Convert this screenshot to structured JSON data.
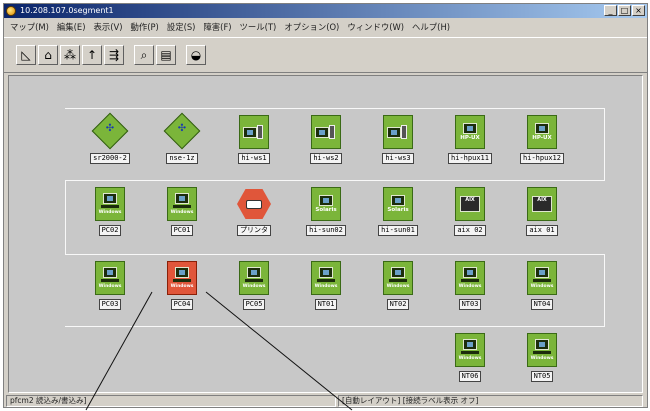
{
  "window": {
    "title": "10.208.107.0segment1",
    "controls": [
      "_",
      "□",
      "×"
    ]
  },
  "menu": [
    "マップ(M)",
    "編集(E)",
    "表示(V)",
    "動作(P)",
    "設定(S)",
    "障害(F)",
    "ツール(T)",
    "オプション(O)",
    "ウィンドウ(W)",
    "ヘルプ(H)"
  ],
  "toolbar": [
    {
      "icon": "triangle-ruler-icon",
      "glyph": "◺"
    },
    {
      "icon": "house-icon",
      "glyph": "⌂"
    },
    {
      "icon": "network-tree-icon",
      "glyph": "⁂"
    },
    {
      "icon": "up-arrow-icon",
      "glyph": "↑"
    },
    {
      "icon": "branch-arrow-icon",
      "glyph": "⇶"
    },
    {
      "icon": "magnifier-icon",
      "glyph": "⌕"
    },
    {
      "icon": "chart-icon",
      "glyph": "▤"
    },
    {
      "icon": "dome-icon",
      "glyph": "◒"
    }
  ],
  "nodes": [
    {
      "label": "sr2000-2",
      "type": "router"
    },
    {
      "label": "nse-1z",
      "type": "router"
    },
    {
      "label": "hi-ws1",
      "type": "server"
    },
    {
      "label": "hi-ws2",
      "type": "server"
    },
    {
      "label": "hi-ws3",
      "type": "server"
    },
    {
      "label": "hi-hpux11",
      "type": "hp",
      "os": "HP-UX"
    },
    {
      "label": "hi-hpux12",
      "type": "hp",
      "os": "HP-UX"
    },
    {
      "label": "PC02",
      "type": "pc",
      "os": "Windows"
    },
    {
      "label": "PC01",
      "type": "pc",
      "os": "Windows"
    },
    {
      "label": "プリンタ",
      "type": "printer"
    },
    {
      "label": "hi-sun02",
      "type": "sun",
      "os": "Solaris"
    },
    {
      "label": "hi-sun01",
      "type": "sun",
      "os": "Solaris"
    },
    {
      "label": "aix 02",
      "type": "aix",
      "os": "AIX"
    },
    {
      "label": "aix 01",
      "type": "aix",
      "os": "AIX"
    },
    {
      "label": "PC03",
      "type": "pc",
      "os": "Windows"
    },
    {
      "label": "PC04",
      "type": "pc",
      "os": "Windows",
      "selected": true
    },
    {
      "label": "PC05",
      "type": "pc",
      "os": "Windows"
    },
    {
      "label": "NT01",
      "type": "pc",
      "os": "Windows"
    },
    {
      "label": "NT02",
      "type": "pc",
      "os": "Windows"
    },
    {
      "label": "NT03",
      "type": "pc",
      "os": "Windows"
    },
    {
      "label": "NT04",
      "type": "pc",
      "os": "Windows"
    },
    {
      "label": "NT06",
      "type": "pc",
      "os": "Windows"
    },
    {
      "label": "NT05",
      "type": "pc",
      "os": "Windows"
    }
  ],
  "status": {
    "left": "pfcm2 読込み/書込み]",
    "right": "[自動レイアウト] [接続ラベル表示 オフ]"
  },
  "colors": {
    "node_green": "#7bb53a",
    "node_selected": "#e0563a",
    "canvas_bg": "#c8c8c8",
    "titlebar": "#0a246a"
  }
}
